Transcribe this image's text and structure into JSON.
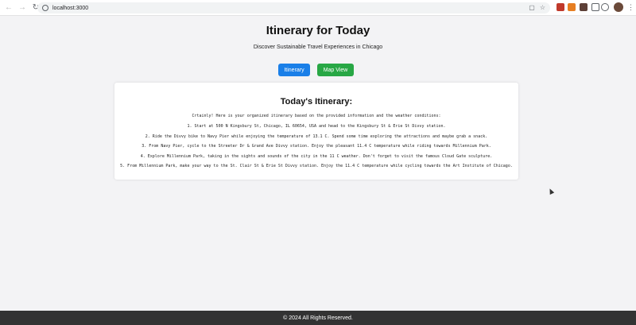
{
  "browser": {
    "url": "localhost:3000",
    "icons": [
      "back-icon",
      "forward-icon",
      "reload-icon",
      "site-info-icon",
      "install-icon",
      "star-icon",
      "extensions-icon",
      "profile-icon",
      "menu-icon"
    ]
  },
  "header": {
    "title": "Itinerary for Today",
    "subtitle": "Discover Sustainable Travel Experiences in Chicago"
  },
  "buttons": {
    "itinerary": "Itinerary",
    "map_view": "Map View",
    "itinerary_color": "#1a7fe8",
    "map_view_color": "#28a745"
  },
  "card": {
    "title": "Today's Itinerary:",
    "lines": [
      "Crtainly! Here is your organized itinerary based on the provided information and the weather conditions:",
      "1. Start at 500 N Kingsbury St, Chicago, IL 60654, USA and head to the Kingsbury St & Erie St Divvy station.",
      "2. Ride the Divvy bike to Navy Pier while enjoying the temperature of 13.1 C. Spend some time exploring the attractions and maybe grab a snack.",
      "3. From Navy Pier, cycle to the Streeter Dr & Grand Ave Divvy station. Enjoy the pleasant 11.4 C temperature while riding towards Millennium Park.",
      "4. Explore Millennium Park, taking in the sights and sounds of the city in the 11 C weather. Don't forget to visit the famous Cloud Gate sculpture.",
      "5. From Millennium Park, make your way to the St. Clair St & Erie St Divvy station. Enjoy the 11.4 C temperature while cycling towards the Art Institute of Chicago."
    ]
  },
  "footer": {
    "text": "© 2024 All Rights Reserved."
  }
}
